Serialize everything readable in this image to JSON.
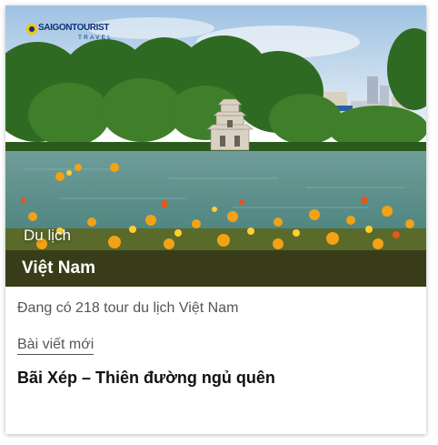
{
  "card": {
    "logo": {
      "brand": "SAIGONTOURIST",
      "sub": "TRAVEL"
    },
    "category": "Du lịch",
    "title": "Việt Nam",
    "tour_count_text": "Đang có 218 tour du lịch Việt Nam",
    "news_label": "Bài viết mới",
    "headline": "Bãi Xép – Thiên đường ngủ quên"
  },
  "colors": {
    "brand_blue": "#0d2f7a",
    "title_overlay": "#1e160a",
    "body_text": "#555555",
    "headline_text": "#111111"
  }
}
